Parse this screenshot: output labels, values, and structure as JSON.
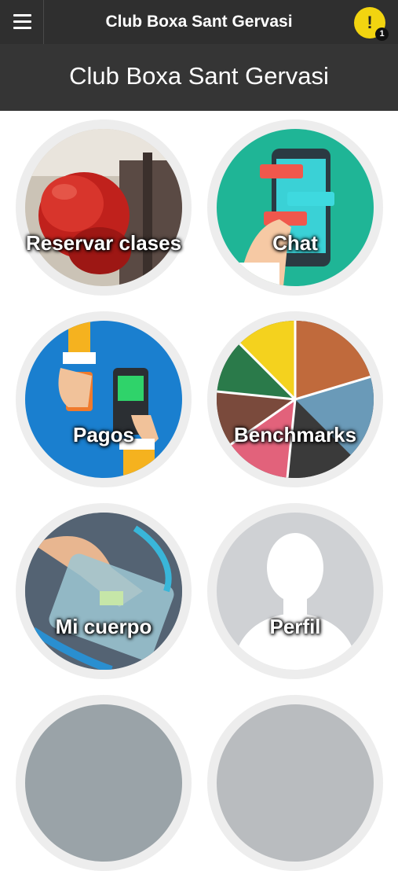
{
  "app": {
    "title": "Club Boxa Sant Gervasi",
    "alert_icon": "!",
    "alert_count": "1"
  },
  "header": {
    "club_name": "Club Boxa Sant Gervasi"
  },
  "tiles": [
    {
      "label": "Reservar clases",
      "icon": "boxing-glove-icon"
    },
    {
      "label": "Chat",
      "icon": "chat-phone-icon"
    },
    {
      "label": "Pagos",
      "icon": "card-payment-icon"
    },
    {
      "label": "Benchmarks",
      "icon": "sports-collage-icon"
    },
    {
      "label": "Mi cuerpo",
      "icon": "body-scale-icon"
    },
    {
      "label": "Perfil",
      "icon": "user-silhouette-icon"
    }
  ],
  "colors": {
    "topbar": "#2f2f2f",
    "header_band": "#353535",
    "accent_yellow": "#f2d410",
    "tile_ring": "#ededed"
  }
}
